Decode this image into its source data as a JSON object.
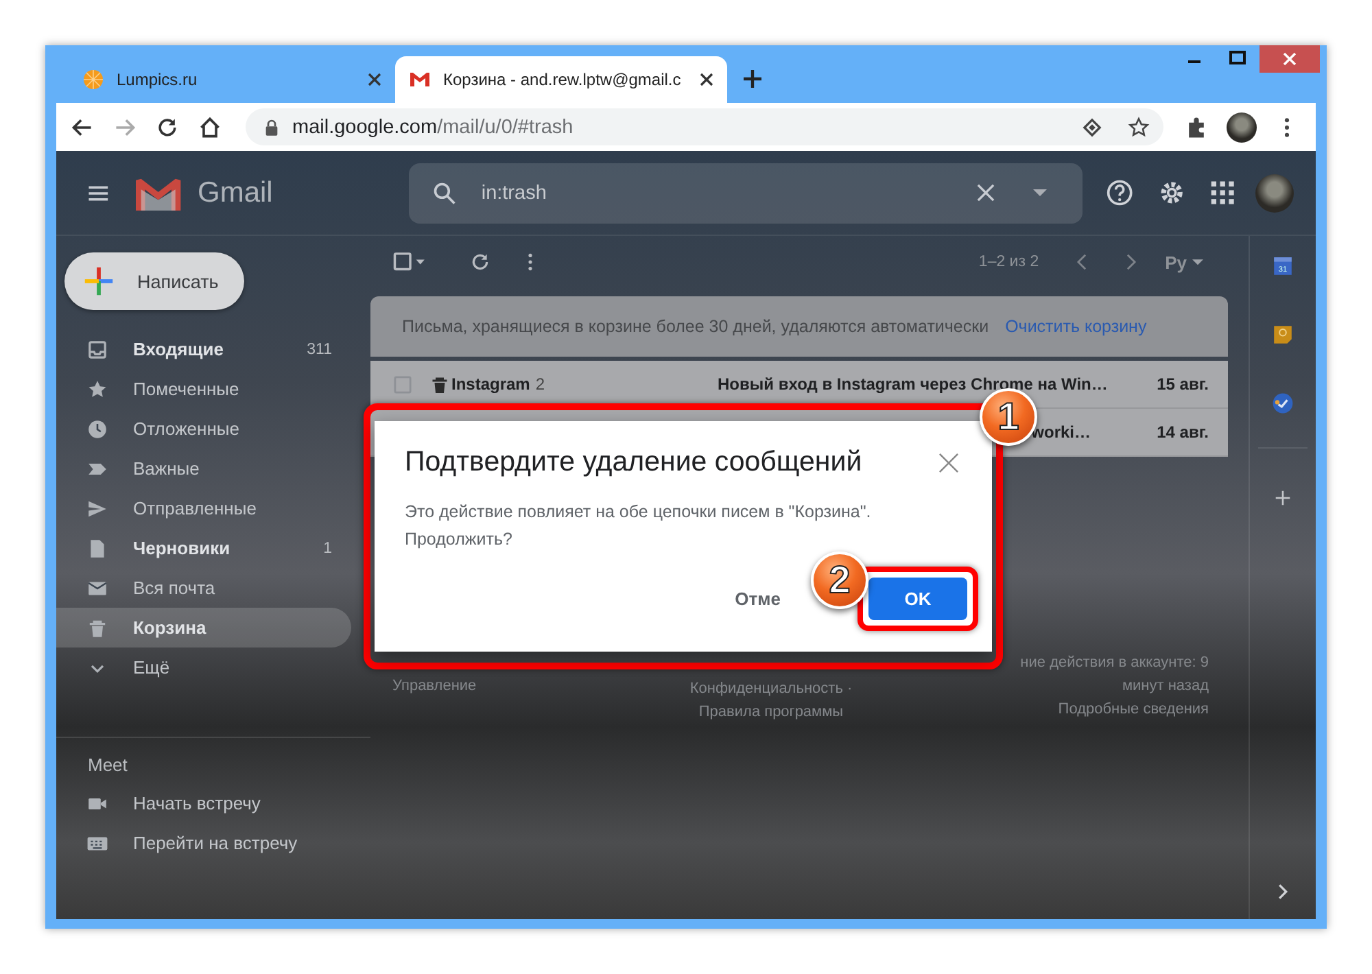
{
  "browser": {
    "tabs": [
      {
        "title": "Lumpics.ru",
        "selected": false
      },
      {
        "title": "Корзина - and.rew.lptw@gmail.c",
        "selected": true
      }
    ],
    "url": {
      "host": "mail.google.com",
      "path": "/mail/u/0/#trash"
    }
  },
  "gmail": {
    "product": "Gmail",
    "search": {
      "value": "in:trash"
    },
    "compose": "Написать",
    "folders": [
      {
        "label": "Входящие",
        "count": "311",
        "unread": true,
        "selected": false
      },
      {
        "label": "Помеченные",
        "unread": false,
        "selected": false
      },
      {
        "label": "Отложенные",
        "unread": false,
        "selected": false
      },
      {
        "label": "Важные",
        "unread": false,
        "selected": false
      },
      {
        "label": "Отправленные",
        "unread": false,
        "selected": false
      },
      {
        "label": "Черновики",
        "count": "1",
        "unread": true,
        "selected": false
      },
      {
        "label": "Вся почта",
        "unread": false,
        "selected": false
      },
      {
        "label": "Корзина",
        "unread": true,
        "selected": true
      },
      {
        "label": "Ещё",
        "unread": false,
        "selected": false
      }
    ],
    "meet": {
      "title": "Meet",
      "items": [
        {
          "label": "Начать встречу"
        },
        {
          "label": "Перейти на встречу"
        }
      ]
    },
    "side_panel": {
      "calendar_day": "31"
    },
    "toolbar": {
      "range": "1–2 из 2",
      "input_tool": "Ру"
    },
    "banner": {
      "text": "Письма, хранящиеся в корзине более 30 дней, удаляются автоматически",
      "action": "Очистить корзину"
    },
    "rows": [
      {
        "sender": "Instagram",
        "count": "2",
        "subject": "Новый вход в Instagram через Chrome на Win…",
        "date": "15 авг.",
        "checked": false
      },
      {
        "subject": "worki…",
        "date": "14 авг."
      }
    ],
    "footer": {
      "left": "Управление",
      "middle": "Конфиденциальность · Правила программы",
      "right": [
        "ние действия в аккаунте: 9 минут назад",
        "Подробные сведения"
      ]
    }
  },
  "dialog": {
    "title": "Подтвердите удаление сообщений",
    "message": "Это действие повлияет на обе цепочки писем в \"Корзина\". Продолжить?",
    "cancel": "Отме",
    "ok": "OK"
  },
  "annotations": [
    {
      "number": "1"
    },
    {
      "number": "2"
    }
  ]
}
